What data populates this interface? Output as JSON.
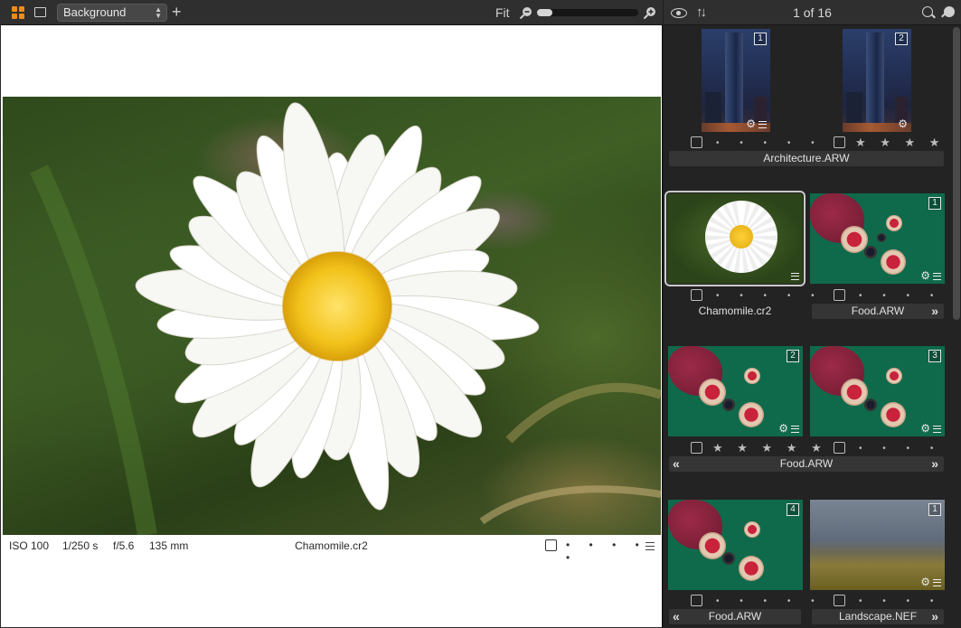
{
  "viewer": {
    "background_select": "Background",
    "zoom_label": "Fit",
    "zoom_level": 0.15,
    "filename": "Chamomile.cr2",
    "exif": {
      "iso": "ISO 100",
      "shutter": "1/250 s",
      "aperture": "f/5.6",
      "focal": "135 mm"
    },
    "rating_dots": "• • • • •"
  },
  "browser": {
    "counter": "1 of 16",
    "groups": [
      {
        "name": "Architecture.ARW",
        "cells": [
          {
            "badge": "1",
            "stars": "• • • • •",
            "rating": 0
          },
          {
            "badge": "2",
            "stars": "★ ★ ★ ★ •",
            "rating": 4
          }
        ]
      },
      {
        "cells": [
          {
            "name": "Chamomile.cr2",
            "stars": "• • • • •",
            "rating": 0,
            "selected": true
          },
          {
            "name": "Food.ARW",
            "badge": "1",
            "stars": "• • • • •",
            "rating": 0,
            "nav_next": "»"
          }
        ]
      },
      {
        "name": "Food.ARW",
        "nav_prev": "«",
        "nav_next": "»",
        "cells": [
          {
            "badge": "2",
            "stars": "★ ★ ★ ★ ★",
            "rating": 5
          },
          {
            "badge": "3",
            "stars": "• • • • •",
            "rating": 0
          }
        ]
      },
      {
        "cells": [
          {
            "name": "Food.ARW",
            "badge": "4",
            "stars": "• • • • •",
            "rating": 0,
            "nav_prev": "«"
          },
          {
            "name": "Landscape.NEF",
            "badge": "1",
            "stars": "• • • • •",
            "rating": 0,
            "nav_next": "»"
          }
        ]
      }
    ]
  },
  "colors": {
    "accent": "#f08a1a",
    "panel": "#232323",
    "toolbar": "#2f2f2f"
  }
}
